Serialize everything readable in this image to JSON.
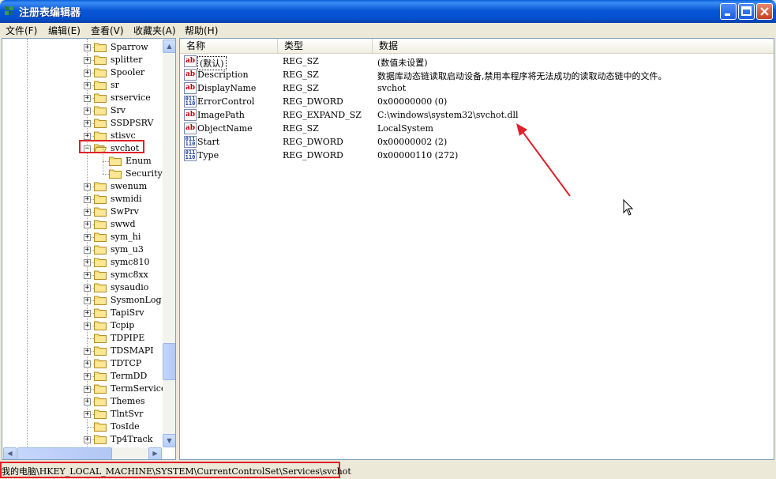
{
  "window": {
    "title": "注册表编辑器"
  },
  "menu": [
    {
      "label": "文件(F)"
    },
    {
      "label": "编辑(E)"
    },
    {
      "label": "查看(V)"
    },
    {
      "label": "收藏夹(A)"
    },
    {
      "label": "帮助(H)"
    }
  ],
  "tree": {
    "items": [
      {
        "label": "Sparrow",
        "expander": "+",
        "depth": 0
      },
      {
        "label": "splitter",
        "expander": "+",
        "depth": 0
      },
      {
        "label": "Spooler",
        "expander": "+",
        "depth": 0
      },
      {
        "label": "sr",
        "expander": "+",
        "depth": 0
      },
      {
        "label": "srservice",
        "expander": "+",
        "depth": 0
      },
      {
        "label": "Srv",
        "expander": "+",
        "depth": 0
      },
      {
        "label": "SSDPSRV",
        "expander": "+",
        "depth": 0
      },
      {
        "label": "stisvc",
        "expander": "+",
        "depth": 0
      },
      {
        "label": "svchot",
        "expander": "-",
        "depth": 0,
        "selected": true,
        "open": true
      },
      {
        "label": "Enum",
        "expander": "",
        "depth": 1
      },
      {
        "label": "Security",
        "expander": "",
        "depth": 1
      },
      {
        "label": "swenum",
        "expander": "+",
        "depth": 0
      },
      {
        "label": "swmidi",
        "expander": "+",
        "depth": 0
      },
      {
        "label": "SwPrv",
        "expander": "+",
        "depth": 0
      },
      {
        "label": "swwd",
        "expander": "+",
        "depth": 0
      },
      {
        "label": "sym_hi",
        "expander": "+",
        "depth": 0
      },
      {
        "label": "sym_u3",
        "expander": "+",
        "depth": 0
      },
      {
        "label": "symc810",
        "expander": "+",
        "depth": 0
      },
      {
        "label": "symc8xx",
        "expander": "+",
        "depth": 0
      },
      {
        "label": "sysaudio",
        "expander": "+",
        "depth": 0
      },
      {
        "label": "SysmonLog",
        "expander": "+",
        "depth": 0
      },
      {
        "label": "TapiSrv",
        "expander": "+",
        "depth": 0
      },
      {
        "label": "Tcpip",
        "expander": "+",
        "depth": 0
      },
      {
        "label": "TDPIPE",
        "expander": "",
        "depth": 0
      },
      {
        "label": "TDSMAPI",
        "expander": "+",
        "depth": 0
      },
      {
        "label": "TDTCP",
        "expander": "+",
        "depth": 0
      },
      {
        "label": "TermDD",
        "expander": "+",
        "depth": 0
      },
      {
        "label": "TermService",
        "expander": "+",
        "depth": 0
      },
      {
        "label": "Themes",
        "expander": "+",
        "depth": 0
      },
      {
        "label": "TlntSvr",
        "expander": "+",
        "depth": 0
      },
      {
        "label": "TosIde",
        "expander": "",
        "depth": 0
      },
      {
        "label": "Tp4Track",
        "expander": "+",
        "depth": 0
      }
    ]
  },
  "list": {
    "columns": [
      {
        "label": "名称"
      },
      {
        "label": "类型"
      },
      {
        "label": "数据"
      }
    ],
    "rows": [
      {
        "icon": "string-value-icon",
        "name": "(默认)",
        "type": "REG_SZ",
        "data": "(数值未设置)"
      },
      {
        "icon": "string-value-icon",
        "name": "Description",
        "type": "REG_SZ",
        "data": "数据库动态链读取启动设备,禁用本程序将无法成功的读取动态链中的文件。"
      },
      {
        "icon": "string-value-icon",
        "name": "DisplayName",
        "type": "REG_SZ",
        "data": "svchot"
      },
      {
        "icon": "dword-value-icon",
        "name": "ErrorControl",
        "type": "REG_DWORD",
        "data": "0x00000000 (0)"
      },
      {
        "icon": "string-value-icon",
        "name": "ImagePath",
        "type": "REG_EXPAND_SZ",
        "data": "C:\\windows\\system32\\svchot.dll"
      },
      {
        "icon": "string-value-icon",
        "name": "ObjectName",
        "type": "REG_SZ",
        "data": "LocalSystem"
      },
      {
        "icon": "dword-value-icon",
        "name": "Start",
        "type": "REG_DWORD",
        "data": "0x00000002 (2)"
      },
      {
        "icon": "dword-value-icon",
        "name": "Type",
        "type": "REG_DWORD",
        "data": "0x00000110 (272)"
      }
    ]
  },
  "status": {
    "path": "我的电脑\\HKEY_LOCAL_MACHINE\\SYSTEM\\CurrentControlSet\\Services\\svchot"
  },
  "colors": {
    "annotation": "#e0202a",
    "titlebar": "#0857d6"
  }
}
